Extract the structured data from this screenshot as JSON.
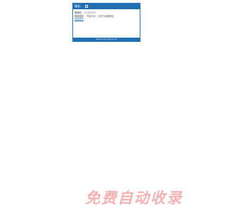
{
  "dialog": {
    "header": {
      "title": "服务：",
      "icon": "window-icon"
    },
    "body": {
      "error_code_label": "错误码：",
      "error_code_value": "114747(?)",
      "error_desc_label": "错误描述：",
      "error_desc_value": "不能访问，文件已经被移动。",
      "back_link": "返回首页"
    },
    "footer": "Powered by JiujiCms V3"
  },
  "watermark": "免费自动收录",
  "colors": {
    "header_bg": "#1f6fb2",
    "border": "#2a78b8",
    "watermark": "#f3b3b3"
  }
}
